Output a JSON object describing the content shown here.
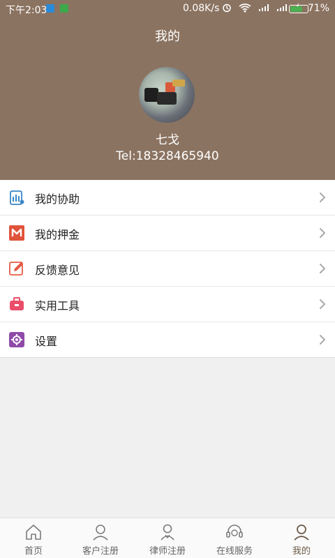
{
  "status_bar": {
    "time": "下午2:03",
    "speed": "0.08K/s",
    "battery_percent": "71%",
    "battery_level": 0.71
  },
  "header": {
    "title": "我的",
    "user": {
      "name": "七戈",
      "tel": "Tel:18328465940"
    }
  },
  "menu": {
    "items": [
      {
        "label": "我的协助",
        "icon": "assist-chart-icon"
      },
      {
        "label": "我的押金",
        "icon": "deposit-m-icon"
      },
      {
        "label": "反馈意见",
        "icon": "feedback-pencil-icon"
      },
      {
        "label": "实用工具",
        "icon": "toolbox-icon"
      },
      {
        "label": "设置",
        "icon": "settings-gear-icon"
      }
    ]
  },
  "bottom_nav": {
    "items": [
      {
        "label": "首页",
        "icon": "home-icon",
        "active": false
      },
      {
        "label": "客户注册",
        "icon": "customer-icon",
        "active": false
      },
      {
        "label": "律师注册",
        "icon": "lawyer-icon",
        "active": false
      },
      {
        "label": "在线服务",
        "icon": "headset-icon",
        "active": false
      },
      {
        "label": "我的",
        "icon": "profile-icon",
        "active": true
      }
    ]
  },
  "colors": {
    "header_bg": "#8b7361",
    "page_bg": "#f0f0f0",
    "accent_active": "#6b5a48",
    "menu_deposit_red": "#e0533a",
    "menu_toolbox_pink": "#ea4e6a",
    "menu_settings_purple": "#8f4aa8",
    "menu_assist_blue": "#3a86c8",
    "menu_feedback_red": "#e45b45"
  }
}
